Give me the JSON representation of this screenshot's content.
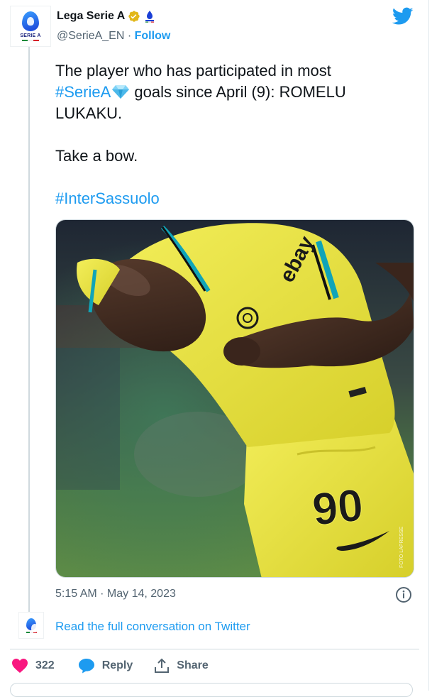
{
  "author": {
    "display_name": "Lega Serie A",
    "handle": "@SerieA_EN",
    "separator": "·",
    "follow_label": "Follow",
    "avatar_text": "SERIE A"
  },
  "tweet": {
    "line1": "The player who has participated in most",
    "hashtag1": "#SerieA",
    "line2_rest": " goals since April (9): ROMELU LUKAKU.",
    "line3": "Take a bow.",
    "hashtag2": "#InterSassuolo"
  },
  "photo": {
    "sponsor": "ebay",
    "shirt_number": "90",
    "credit": "FOTO LAPRESSE"
  },
  "meta": {
    "timestamp": "5:15 AM · May 14, 2023"
  },
  "conversation": {
    "link_text": "Read the full conversation on Twitter"
  },
  "actions": {
    "likes": "322",
    "reply_label": "Reply",
    "share_label": "Share"
  },
  "colors": {
    "accent": "#1d9bf0",
    "like": "#f91880",
    "text": "#0f1419",
    "secondary": "#536471",
    "jersey": "#e8e23a"
  }
}
